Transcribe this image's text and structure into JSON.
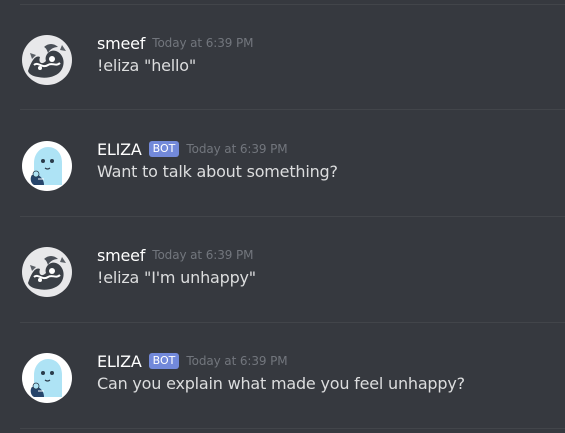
{
  "messages": [
    {
      "author": "smeef",
      "is_bot": false,
      "bot_tag": "",
      "timestamp": "Today at 6:39 PM",
      "content": "!eliza \"hello\"",
      "avatar_icon": "smeef-avatar"
    },
    {
      "author": "ELIZA",
      "is_bot": true,
      "bot_tag": "BOT",
      "timestamp": "Today at 6:39 PM",
      "content": "Want to talk about something?",
      "avatar_icon": "eliza-ghost-avatar"
    },
    {
      "author": "smeef",
      "is_bot": false,
      "bot_tag": "",
      "timestamp": "Today at 6:39 PM",
      "content": "!eliza \"I'm unhappy\"",
      "avatar_icon": "smeef-avatar"
    },
    {
      "author": "ELIZA",
      "is_bot": true,
      "bot_tag": "BOT",
      "timestamp": "Today at 6:39 PM",
      "content": "Can you explain what made you feel unhappy?",
      "avatar_icon": "eliza-ghost-avatar"
    }
  ],
  "colors": {
    "background": "#36393f",
    "divider": "#42454a",
    "username": "#ffffff",
    "message_text": "#dcddde",
    "timestamp": "#72767d",
    "bot_tag": "#7289da",
    "eliza_avatar_bg": "#ffffff",
    "eliza_ghost": "#aee3f5",
    "smeef_avatar_bg": "#e8e8ea"
  }
}
